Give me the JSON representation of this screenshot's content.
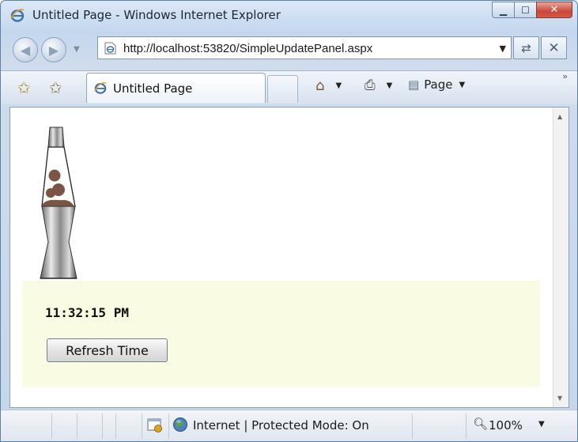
{
  "window": {
    "title": "Untitled Page - Windows Internet Explorer"
  },
  "caption_buttons": {
    "minimize_icon": "minimize-icon",
    "maximize_icon": "maximize-icon",
    "close_icon": "close-icon"
  },
  "address": {
    "url": "http://localhost:53820/SimpleUpdatePanel.aspx"
  },
  "tab": {
    "label": "Untitled Page"
  },
  "commands": {
    "page_label": "Page"
  },
  "content": {
    "time": "11:32:15 PM",
    "refresh_button": "Refresh Time",
    "panel_color": "#f9fbe3"
  },
  "status": {
    "zone": "Internet | Protected Mode: On",
    "zoom": "100%"
  }
}
